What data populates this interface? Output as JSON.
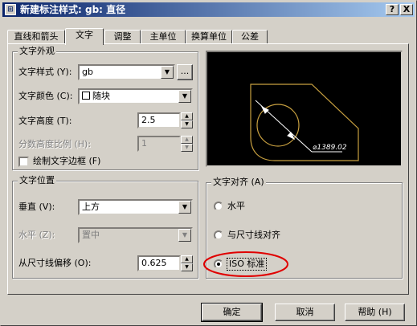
{
  "window": {
    "title": "新建标注样式: gb: 直径",
    "help_btn": "?",
    "close_btn": "X",
    "app_icon": "autocad-icon"
  },
  "tabs": [
    {
      "label": "直线和箭头"
    },
    {
      "label": "文字"
    },
    {
      "label": "调整"
    },
    {
      "label": "主单位"
    },
    {
      "label": "换算单位"
    },
    {
      "label": "公差"
    }
  ],
  "text_appearance": {
    "legend": "文字外观",
    "style_label": "文字样式 (Y):",
    "style_value": "gb",
    "browse_btn": "...",
    "color_label": "文字颜色 (C):",
    "color_value": "随块",
    "height_label": "文字高度 (T):",
    "height_value": "2.5",
    "fraction_label": "分数高度比例 (H):",
    "fraction_value": "1",
    "frame_label": "绘制文字边框 (F)"
  },
  "text_placement": {
    "legend": "文字位置",
    "vertical_label": "垂直 (V):",
    "vertical_value": "上方",
    "horizontal_label": "水平 (Z):",
    "horizontal_value": "置中",
    "offset_label": "从尺寸线偏移 (O):",
    "offset_value": "0.625"
  },
  "text_alignment": {
    "legend": "文字对齐 (A)",
    "options": [
      {
        "label": "水平",
        "selected": false
      },
      {
        "label": "与尺寸线对齐",
        "selected": false
      },
      {
        "label": "ISO 标准",
        "selected": true
      }
    ]
  },
  "preview": {
    "dimension_text": "⌀1389.02",
    "line_color": "#c8a040",
    "text_color": "#ffffff"
  },
  "buttons": {
    "ok": "确定",
    "cancel": "取消",
    "help": "帮助 (H)"
  },
  "annotation_color": "#e00000"
}
